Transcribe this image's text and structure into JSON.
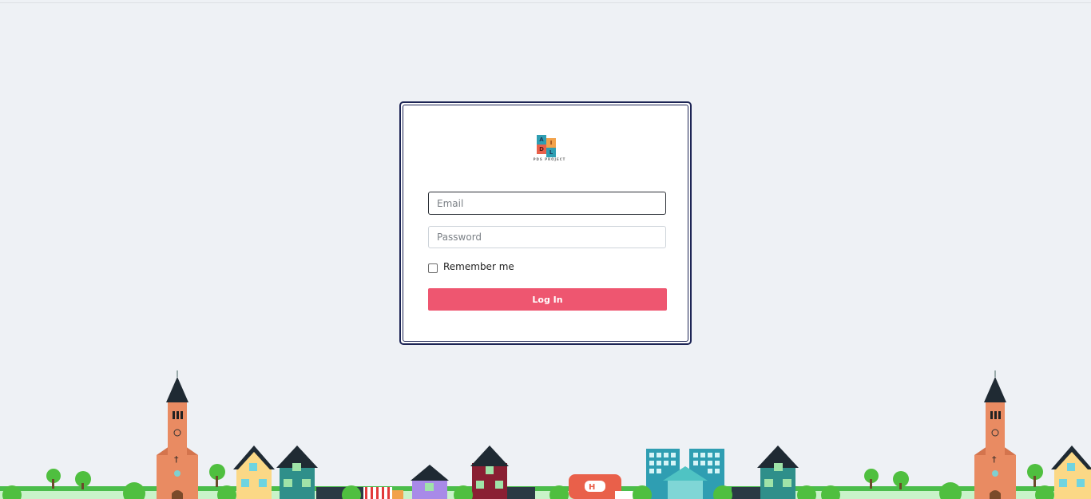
{
  "logo": {
    "letters": [
      "A",
      "I",
      "D",
      "L"
    ],
    "caption": "PDS PROJECT",
    "colors": [
      "#2f9eb2",
      "#f2a24b",
      "#e9604a",
      "#2f9eb2"
    ]
  },
  "form": {
    "email_placeholder": "Email",
    "password_placeholder": "Password",
    "remember_label": "Remember me",
    "remember_checked": false,
    "login_label": "Log In"
  },
  "colors": {
    "background": "#eef1f5",
    "card_border": "#1d2555",
    "button": "#ee5670"
  }
}
